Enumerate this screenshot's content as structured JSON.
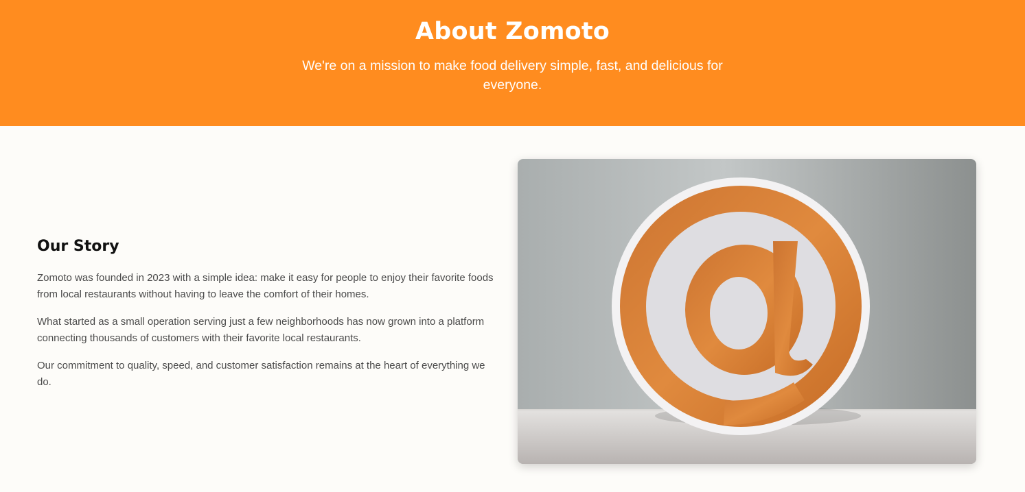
{
  "hero": {
    "title": "About Zomoto",
    "subtitle": "We're on a mission to make food delivery simple, fast, and delicious for everyone.",
    "background": "#ff8c1f"
  },
  "story": {
    "heading": "Our Story",
    "paragraphs": [
      "Zomoto was founded in 2023 with a simple idea: make it easy for people to enjoy their favorite foods from local restaurants without having to leave the comfort of their homes.",
      "What started as a small operation serving just a few neighborhoods has now grown into a platform connecting thousands of customers with their favorite local restaurants.",
      "Our commitment to quality, speed, and customer satisfaction remains at the heart of everything we do."
    ]
  },
  "image": {
    "subject": "orange at-sign sign on a shelf",
    "accent": "#d9782a"
  }
}
